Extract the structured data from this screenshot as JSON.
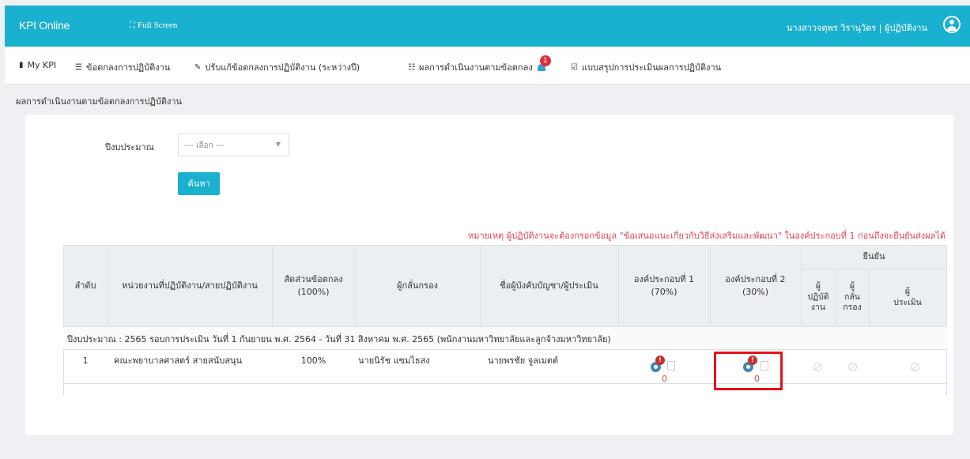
{
  "topbar": {
    "brand": "KPI Online",
    "fullscreen_label": "Full Screen",
    "user_name": "นางสาวจตุพร วิรานุวัตร | ผู้ปฏิบัติงาน"
  },
  "menu": [
    {
      "label": "My KPI",
      "icon": "bookmark-icon"
    },
    {
      "label": "ข้อตกลงการปฏิบัติงาน",
      "icon": "list-icon"
    },
    {
      "label": "ปรับแก้ข้อตกลงการปฏิบัติงาน (ระหว่างปี)",
      "icon": "eraser-icon"
    },
    {
      "label": "ผลการดำเนินงานตามข้อตกลง",
      "icon": "list-ul-icon",
      "badge": "1"
    },
    {
      "label": "แบบสรุปการประเมินผลการปฏิบัติงาน",
      "icon": "check-square-icon"
    }
  ],
  "page_title": "ผลการดำเนินงานตามข้อตกลงการปฏิบัติงาน",
  "filter": {
    "year_label": "ปีงบประมาณ",
    "year_select_value": "--- เลือก ---",
    "search_button": "ค้นหา"
  },
  "note": "หมายเหตุ ผู้ปฏิบัติงานจะต้องกรอกข้อมูล \"ข้อเสนอแนะเกี่ยวกับวิธีส่งเสริมและพัฒนา\" ในองค์ประกอบที่ 1 ก่อนถึงจะยืนยันส่งผลได้",
  "table": {
    "headers": {
      "no": "ลำดับ",
      "unit": "หน่วยงานที่ปฏิบัติงาน/สายปฏิบัติงาน",
      "ratio_line1": "สัดส่วนข้อตกลง",
      "ratio_line2": "(100%)",
      "screener": "ผู้กลั่นกรอง",
      "supervisor": "ชื่อผู้บังคับบัญชา/ผู้ประเมิน",
      "comp1_line1": "องค์ประกอบที่ 1",
      "comp1_line2": "(70%)",
      "comp2_line1": "องค์ประกอบที่ 2",
      "comp2_line2": "(30%)",
      "confirm": "ยืนยัน",
      "confirm_performer": "ผู้\nปฏิบัติ\nงาน",
      "confirm_screener": "ผู้\nกลั่น\nกรอง",
      "confirm_evaluator": "ผู้\nประเมิน"
    },
    "group_row": "ปีงบประมาณ : 2565 รอบการประเมิน วันที่ 1 กันยายน พ.ศ. 2564 - วันที่ 31 สิงหาคม พ.ศ. 2565 (พนักงานมหาวิทยาลัยและลูกจ้างมหาวิทยาลัย)",
    "rows": [
      {
        "no": "1",
        "unit": "คณะพยาบาลศาสตร์ สายสนับสนุน",
        "ratio": "100%",
        "screener": "นายนิรัช แซมไธสง",
        "supervisor": "นายพรชัย จูลเมตต์",
        "comp1_warning": "!",
        "comp1_count": "0",
        "comp2_warning": "!",
        "comp2_count": "0"
      }
    ]
  },
  "colors": {
    "topbar": "#1ab0cf",
    "note_red": "#e0434f",
    "badge_red": "#d9303c",
    "highlight_box": "#e8101c"
  }
}
